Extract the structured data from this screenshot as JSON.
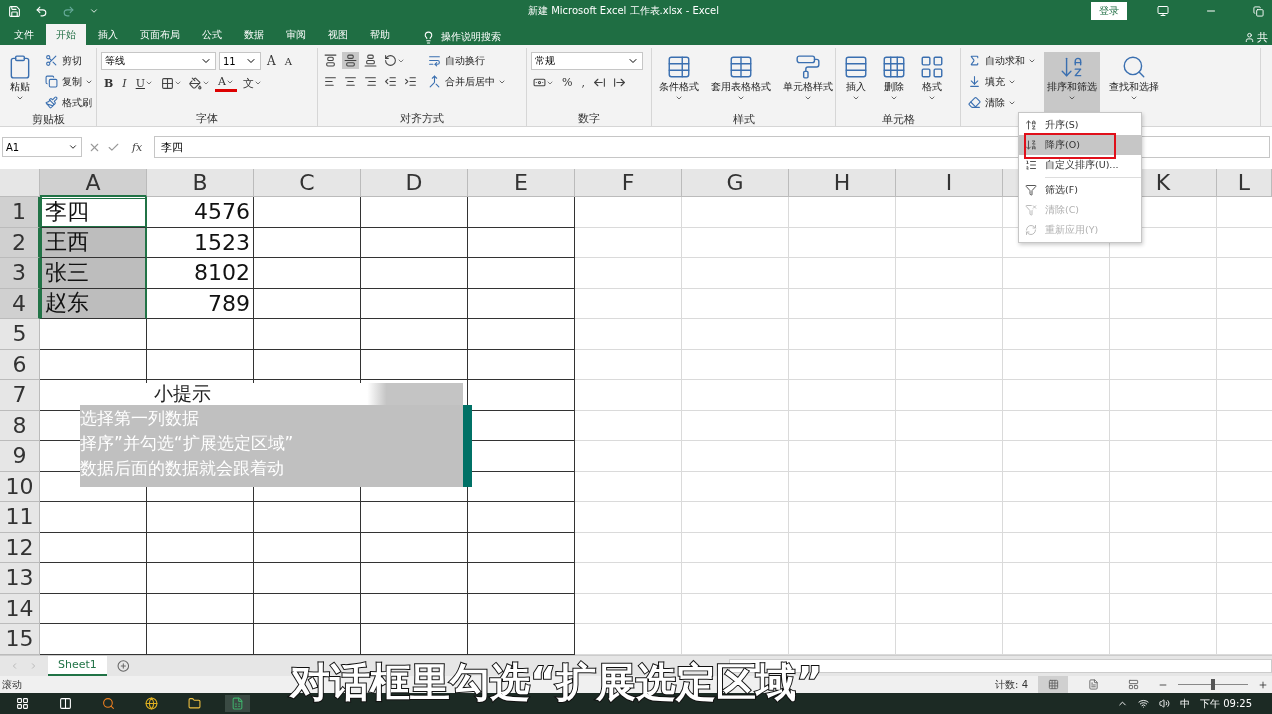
{
  "window": {
    "title": "新建 Microsoft Excel 工作表.xlsx  -  Excel",
    "sign_in": "登录",
    "share": "共"
  },
  "menu_tabs": [
    {
      "label": "文件",
      "selected": false
    },
    {
      "label": "开始",
      "selected": true
    },
    {
      "label": "插入",
      "selected": false
    },
    {
      "label": "页面布局",
      "selected": false
    },
    {
      "label": "公式",
      "selected": false
    },
    {
      "label": "数据",
      "selected": false
    },
    {
      "label": "审阅",
      "selected": false
    },
    {
      "label": "视图",
      "selected": false
    },
    {
      "label": "帮助",
      "selected": false
    }
  ],
  "search_hint": "操作说明搜索",
  "ribbon": {
    "groups": [
      {
        "label": "剪贴板",
        "columns": [
          {
            "kind": "large",
            "label": "粘贴",
            "dropdown": true
          },
          {
            "kind": "stack",
            "items": [
              {
                "kind": "small",
                "label": "剪切"
              },
              {
                "kind": "small",
                "label": "复制",
                "dropdown": true
              },
              {
                "kind": "small",
                "label": "格式刷"
              }
            ]
          }
        ]
      },
      {
        "label": "字体",
        "columns": [
          {
            "kind": "stack",
            "items": [
              {
                "kind": "row",
                "items": [
                  {
                    "kind": "font-field",
                    "value": "等线"
                  },
                  {
                    "kind": "size-field",
                    "value": "11"
                  },
                  {
                    "kind": "grow",
                    "text": "A"
                  },
                  {
                    "kind": "shrink",
                    "text": "A"
                  }
                ]
              },
              {
                "kind": "row",
                "items": [
                  {
                    "kind": "bold",
                    "text": "B"
                  },
                  {
                    "kind": "italic",
                    "text": "I"
                  },
                  {
                    "kind": "underline",
                    "text": "U",
                    "dropdown": true
                  },
                  {
                    "kind": "icon",
                    "dropdown": true
                  },
                  {
                    "kind": "icon",
                    "dropdown": true
                  },
                  {
                    "kind": "color",
                    "text": "A",
                    "dropdown": true
                  },
                  {
                    "kind": "glyph",
                    "text": "文",
                    "dropdown": true
                  }
                ]
              }
            ]
          }
        ]
      },
      {
        "label": "对齐方式",
        "columns": [
          {
            "kind": "stack",
            "items": [
              {
                "kind": "row",
                "items": [
                  {
                    "kind": "icon",
                    "selected": false
                  },
                  {
                    "kind": "icon",
                    "selected": true
                  },
                  {
                    "kind": "icon",
                    "selected": false
                  },
                  {
                    "kind": "icon",
                    "dropdown": true
                  }
                ]
              },
              {
                "kind": "row",
                "items": [
                  {
                    "kind": "icon",
                    "selected": false
                  },
                  {
                    "kind": "icon",
                    "selected": false
                  },
                  {
                    "kind": "icon",
                    "selected": false
                  },
                  {
                    "kind": "icon"
                  },
                  {
                    "kind": "icon"
                  }
                ]
              }
            ]
          },
          {
            "kind": "stack",
            "items": [
              {
                "kind": "small",
                "label": "自动换行"
              },
              {
                "kind": "small",
                "label": "合并后居中",
                "dropdown": true
              }
            ]
          }
        ]
      },
      {
        "label": "数字",
        "columns": [
          {
            "kind": "stack",
            "items": [
              {
                "kind": "row",
                "items": [
                  {
                    "kind": "format-field",
                    "value": "常规"
                  }
                ]
              },
              {
                "kind": "row",
                "items": [
                  {
                    "kind": "icon",
                    "dropdown": true
                  },
                  {
                    "kind": "glyph",
                    "text": "%"
                  },
                  {
                    "kind": "glyph",
                    "text": ","
                  },
                  {
                    "kind": "icon"
                  },
                  {
                    "kind": "icon"
                  }
                ]
              }
            ]
          }
        ]
      },
      {
        "label": "样式",
        "columns": [
          {
            "kind": "large",
            "label": "条件格式",
            "dropdown": true
          },
          {
            "kind": "large",
            "label": "套用表格格式",
            "dropdown": true
          },
          {
            "kind": "large",
            "label": "单元格样式",
            "dropdown": true
          }
        ]
      },
      {
        "label": "单元格",
        "columns": [
          {
            "kind": "large",
            "label": "插入",
            "dropdown": true
          },
          {
            "kind": "large",
            "label": "删除",
            "dropdown": true
          },
          {
            "kind": "large",
            "label": "格式",
            "dropdown": true
          }
        ]
      },
      {
        "columns": [
          {
            "kind": "stack",
            "items": [
              {
                "kind": "small",
                "label": "自动求和",
                "dropdown": true
              },
              {
                "kind": "small",
                "label": "填充",
                "dropdown": true
              },
              {
                "kind": "small",
                "label": "清除",
                "dropdown": true
              }
            ]
          },
          {
            "kind": "large",
            "label": "排序和筛选",
            "dropdown": true,
            "pressed": true
          },
          {
            "kind": "large",
            "label": "查找和选择",
            "dropdown": true,
            "pressed": false
          }
        ]
      }
    ]
  },
  "sort_menu": {
    "sections": [
      [
        {
          "label": "升序(S)",
          "selected": false,
          "disabled": false
        },
        {
          "label": "降序(O)",
          "selected": true,
          "disabled": false
        },
        {
          "label": "自定义排序(U)...",
          "selected": false,
          "disabled": false
        }
      ],
      [
        {
          "label": "筛选(F)",
          "selected": false,
          "disabled": false
        },
        {
          "label": "清除(C)",
          "selected": false,
          "disabled": true
        },
        {
          "label": "重新应用(Y)",
          "selected": false,
          "disabled": true
        }
      ]
    ]
  },
  "formula_bar": {
    "name_box": "A1",
    "fx": "fx",
    "value": "李四"
  },
  "grid": {
    "columns": [
      {
        "label": "A",
        "highlighted": true
      },
      {
        "label": "B",
        "highlighted": false
      },
      {
        "label": "C",
        "highlighted": false
      },
      {
        "label": "D",
        "highlighted": false
      },
      {
        "label": "E",
        "highlighted": false
      },
      {
        "label": "F",
        "highlighted": false
      },
      {
        "label": "G",
        "highlighted": false
      },
      {
        "label": "H",
        "highlighted": false
      },
      {
        "label": "I",
        "highlighted": false
      },
      {},
      {
        "label": "K",
        "highlighted": false
      },
      {
        "label": "L",
        "highlighted": false
      }
    ],
    "rows": [
      {
        "number": "1",
        "highlighted": true,
        "cells": [
          {
            "kind": "text",
            "text": "李四",
            "selected": true,
            "active": true
          },
          {
            "kind": "number",
            "text": "4576",
            "selected": false,
            "active": false
          }
        ]
      },
      {
        "number": "2",
        "highlighted": true,
        "cells": [
          {
            "kind": "text",
            "text": "王西",
            "selected": true,
            "active": false
          },
          {
            "kind": "number",
            "text": "1523",
            "selected": false,
            "active": false
          }
        ]
      },
      {
        "number": "3",
        "highlighted": true,
        "cells": [
          {
            "kind": "text",
            "text": "张三",
            "selected": true,
            "active": false
          },
          {
            "kind": "number",
            "text": "8102",
            "selected": false,
            "active": false
          }
        ]
      },
      {
        "number": "4",
        "highlighted": true,
        "cells": [
          {
            "kind": "text",
            "text": "赵东",
            "selected": true,
            "active": false
          },
          {
            "kind": "number",
            "text": "789",
            "selected": false,
            "active": false
          }
        ]
      },
      {
        "number": "5",
        "highlighted": false
      },
      {
        "number": "6",
        "highlighted": false
      },
      {
        "number": "7",
        "highlighted": false
      },
      {
        "number": "8",
        "highlighted": false
      },
      {
        "number": "9",
        "highlighted": false
      },
      {
        "number": "10",
        "highlighted": false
      },
      {
        "number": "11",
        "highlighted": false
      },
      {
        "number": "12",
        "highlighted": false
      },
      {
        "number": "13",
        "highlighted": false
      },
      {
        "number": "14",
        "highlighted": false
      },
      {
        "number": "15",
        "highlighted": false
      }
    ]
  },
  "tip": {
    "title": "小提示",
    "lines": [
      "选择第一列数据",
      "择序”并勾选“扩展选定区域”",
      "数据后面的数据就会跟着动"
    ]
  },
  "sheet_tabs": [
    {
      "label": "Sheet1",
      "selected": true
    }
  ],
  "status_bar": {
    "mode": "滚动",
    "count": "计数: 4",
    "views": [
      {
        "selected": true
      },
      {
        "selected": false
      },
      {
        "selected": false
      }
    ],
    "zoom": {
      "level": 0.5
    }
  },
  "caption": "对话框里勾选“扩展选定区域”",
  "taskbar": {
    "ime": "中",
    "time": "下午 09:25"
  }
}
